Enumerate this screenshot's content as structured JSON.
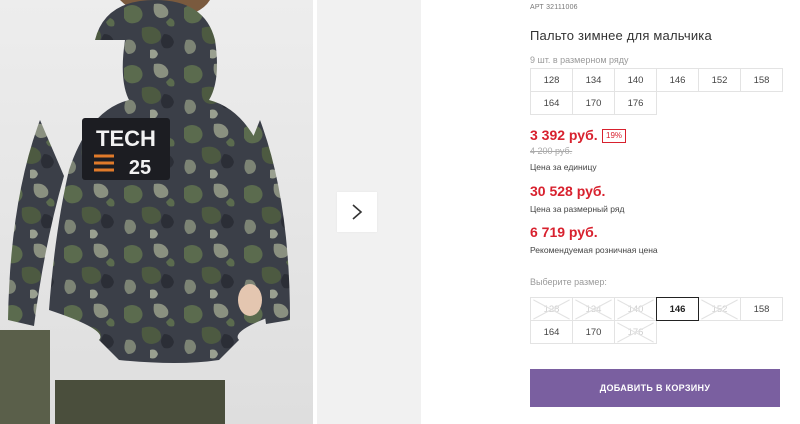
{
  "gallery": {
    "patch_text_line1": "TECH",
    "patch_text_line2": "25",
    "next_icon": "chevron-right-icon"
  },
  "product": {
    "article_label": "АРТ",
    "article_number": "32111006",
    "title": "Пальто зимнее для мальчика",
    "pack_info": "9 шт. в размерном ряду",
    "pack_sizes": [
      "128",
      "134",
      "140",
      "146",
      "152",
      "158",
      "164",
      "170",
      "176"
    ]
  },
  "prices": {
    "unit_price": "3 392 руб.",
    "discount": "19%",
    "old_price": "4 200 руб.",
    "unit_label": "Цена за единицу",
    "range_price": "30 528 руб.",
    "range_label": "Цена за размерный ряд",
    "rrp_price": "6 719 руб.",
    "rrp_label": "Рекомендуемая розничная цена"
  },
  "size_select": {
    "label": "Выберите размер:",
    "options": [
      {
        "value": "128",
        "state": "disabled"
      },
      {
        "value": "134",
        "state": "disabled"
      },
      {
        "value": "140",
        "state": "disabled"
      },
      {
        "value": "146",
        "state": "selected"
      },
      {
        "value": "152",
        "state": "disabled"
      },
      {
        "value": "158",
        "state": "available"
      },
      {
        "value": "164",
        "state": "available"
      },
      {
        "value": "170",
        "state": "available"
      },
      {
        "value": "176",
        "state": "disabled"
      }
    ]
  },
  "cart": {
    "add_label": "ДОБАВИТЬ В КОРЗИНУ"
  },
  "colors": {
    "accent": "#7a5fa0",
    "price_red": "#d8212e"
  }
}
